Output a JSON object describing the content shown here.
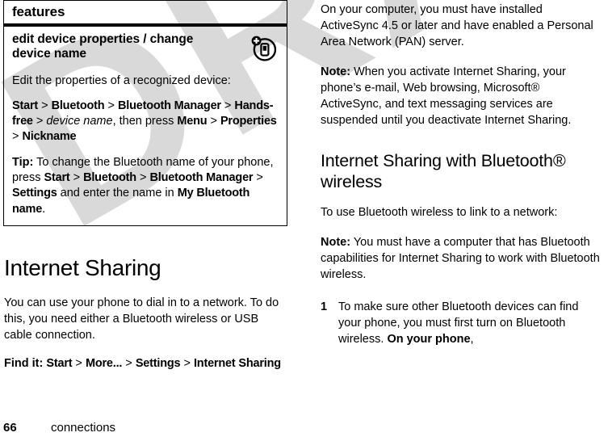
{
  "watermark": {
    "text": "DRAFT",
    "color": "#d9d9d9"
  },
  "feature_table": {
    "header": "features",
    "title": "edit device properties / change device name",
    "icon": "add-device-icon",
    "intro": "Edit the properties of a recognized device:",
    "path": {
      "items": [
        "Start",
        "Bluetooth",
        "Bluetooth Manager",
        "Hands-free",
        "device name",
        "Menu",
        "Properties",
        "Nickname"
      ],
      "separator": ">",
      "then_press": ", then press "
    },
    "tip": {
      "label": "Tip:",
      "text_1": " To change the Bluetooth name of your phone, press ",
      "nav_1": "Start",
      "nav_2": "Bluetooth",
      "nav_3": "Bluetooth Manager",
      "nav_4": "Settings",
      "text_2": " and enter the name in ",
      "nav_5": "My Bluetooth name",
      "text_3": "."
    }
  },
  "left_column": {
    "heading": "Internet Sharing",
    "paragraph": "You can use your phone to dial in to a network. To do this, you need either a Bluetooth wireless or USB cable connection.",
    "find_it": {
      "label": "Find it:",
      "items": [
        "Start",
        "More...",
        "Settings",
        "Internet Sharing"
      ],
      "separator": ">"
    }
  },
  "right_column": {
    "paragraph_1": "On your computer, you must have installed ActiveSync 4.5 or later and have enabled a Personal Area Network (PAN) server.",
    "note_1": {
      "label": "Note:",
      "text": " When you activate Internet Sharing, your phone’s e-mail, Web browsing, Microsoft®  ActiveSync, and text messaging services are suspended until you deactivate Internet Sharing."
    },
    "heading": "Internet Sharing with Bluetooth® wireless",
    "paragraph_2": "To use Bluetooth wireless to link to a network:",
    "note_2": {
      "label": "Note:",
      "text": " You must have a computer that has Bluetooth capabilities for Internet Sharing to work with Bluetooth wireless."
    },
    "step_1": {
      "number": "1",
      "text_1": "To make sure other Bluetooth devices can find your phone, you must first turn on Bluetooth wireless. ",
      "bold": "On your phone",
      "text_2": ","
    }
  },
  "footer": {
    "page_number": "66",
    "section": "connections"
  }
}
